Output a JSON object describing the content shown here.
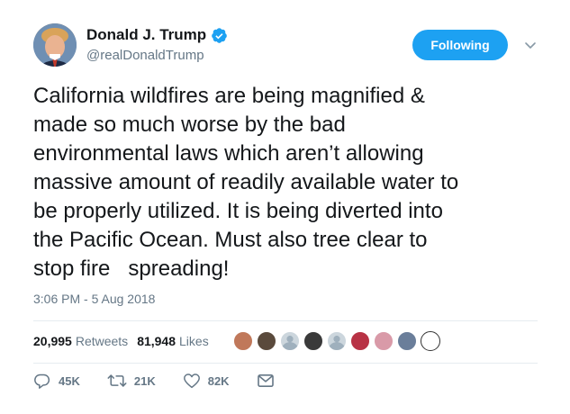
{
  "user": {
    "display_name": "Donald J. Trump",
    "handle": "@realDonaldTrump",
    "verified": true
  },
  "follow_button": {
    "label": "Following"
  },
  "tweet": {
    "text": "California wildfires are being magnified &\nmade so much worse by the bad\nenvironmental laws which aren’t allowing\nmassive amount of readily available water to\nbe properly utilized. It is being diverted into\nthe Pacific Ocean. Must also tree clear to\nstop fire   spreading!",
    "timestamp": "3:06 PM - 5 Aug 2018"
  },
  "stats": {
    "retweets_count": "20,995",
    "retweets_label": "Retweets",
    "likes_count": "81,948",
    "likes_label": "Likes"
  },
  "liker_faces": [
    {
      "color": "#c0785a"
    },
    {
      "color": "#5a4a3c"
    },
    {
      "color": "#ccd6dd"
    },
    {
      "color": "#3a3a3a"
    },
    {
      "color": "#ccd6dd"
    },
    {
      "color": "#b83245"
    },
    {
      "color": "#d99aa8"
    },
    {
      "color": "#6a7e9a"
    },
    {
      "color": "#eaeaea"
    }
  ],
  "actions": {
    "reply_count": "45K",
    "retweet_count": "21K",
    "like_count": "82K"
  },
  "icons": {
    "verified": "verified-badge-icon",
    "caret": "chevron-down-icon",
    "reply": "reply-icon",
    "retweet": "retweet-icon",
    "like": "heart-icon",
    "message": "envelope-icon"
  },
  "colors": {
    "accent": "#1da1f2",
    "secondary_text": "#657786",
    "primary_text": "#14171a"
  }
}
